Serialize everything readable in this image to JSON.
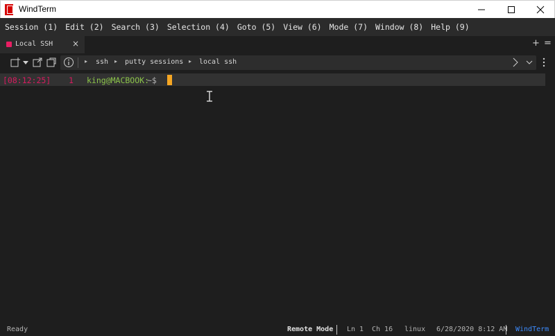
{
  "window": {
    "title": "WindTerm",
    "brand_color": "#d50000"
  },
  "menu": {
    "items": [
      {
        "label": "Session (1)"
      },
      {
        "label": "Edit (2)"
      },
      {
        "label": "Search (3)"
      },
      {
        "label": "Selection (4)"
      },
      {
        "label": "Goto (5)"
      },
      {
        "label": "View (6)"
      },
      {
        "label": "Mode (7)"
      },
      {
        "label": "Window (8)"
      },
      {
        "label": "Help (9)"
      }
    ]
  },
  "tabs": {
    "active_label": "Local SSH",
    "close_glyph": "×",
    "add_glyph": "+",
    "menu_glyph": "=",
    "dot_color": "#e91e63"
  },
  "toolbar": {
    "icons": [
      "new-session-icon",
      "dropdown-arrow-icon",
      "open-external-icon",
      "duplicate-session-icon",
      "info-icon"
    ],
    "breadcrumb": [
      "ssh",
      "putty sessions",
      "local ssh"
    ],
    "crumb_arrow": "▸"
  },
  "terminal": {
    "timestamp": "[08:12:25]",
    "line_number": "1",
    "prompt_user": "king@MACBOOK:",
    "prompt_symbol": "~$",
    "timestamp_color": "#d81b60",
    "prompt_color": "#8bc34a",
    "cursor_color": "#f5a623"
  },
  "status": {
    "state": "Ready",
    "mode": "Remote Mode",
    "line": "Ln 1",
    "column": "Ch 16",
    "os": "linux",
    "datetime": "6/28/2020 8:12 AM",
    "app": "WindTerm",
    "accent_color": "#3d8bfd"
  }
}
